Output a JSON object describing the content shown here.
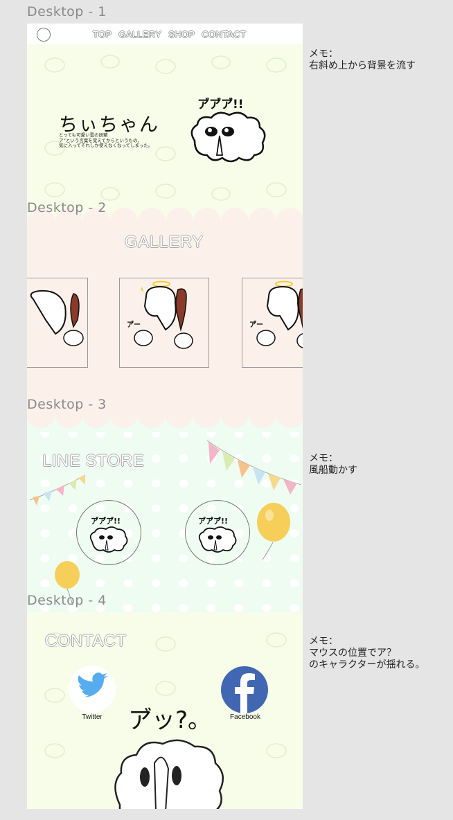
{
  "frames": {
    "d1": "Desktop - 1",
    "d2": "Desktop - 2",
    "d3": "Desktop - 3",
    "d4": "Desktop - 4"
  },
  "nav": {
    "items": [
      {
        "label": "TOP"
      },
      {
        "label": "GALLERY"
      },
      {
        "label": "SHOP"
      },
      {
        "label": "CONTACT"
      }
    ]
  },
  "hero": {
    "title": "ちぃちゃん",
    "description": "とっても可愛い雲の妖精\nア”という言葉を覚えてからというもの、\n気に入ってそれしか使えなくなってしまった。",
    "shout": "ア゙ア゙ア゙!!"
  },
  "gallery": {
    "title": "GALLERY",
    "card_caption": "ア゙ー"
  },
  "store": {
    "title": "LINE STORE",
    "sticker_text": "ア゙ア゙ア゙!!"
  },
  "contact": {
    "title": "CONTACT",
    "twitter_label": "Twitter",
    "facebook_label": "Facebook",
    "character_text": "ア゙ッ?。"
  },
  "notes": {
    "n1": "メモ：\n右斜め上から背景を流す",
    "n2": "メモ：\n風船動かす",
    "n3": "メモ：\nマウスの位置でア？\nのキャラクターが揺れる。"
  },
  "colors": {
    "hero_bg": "#f7fde8",
    "gallery_bg": "#fcf0ea",
    "store_bg": "#eefcf2",
    "balloon": "#f5cf5a",
    "twitter": "#55acee",
    "facebook": "#4267b2"
  }
}
